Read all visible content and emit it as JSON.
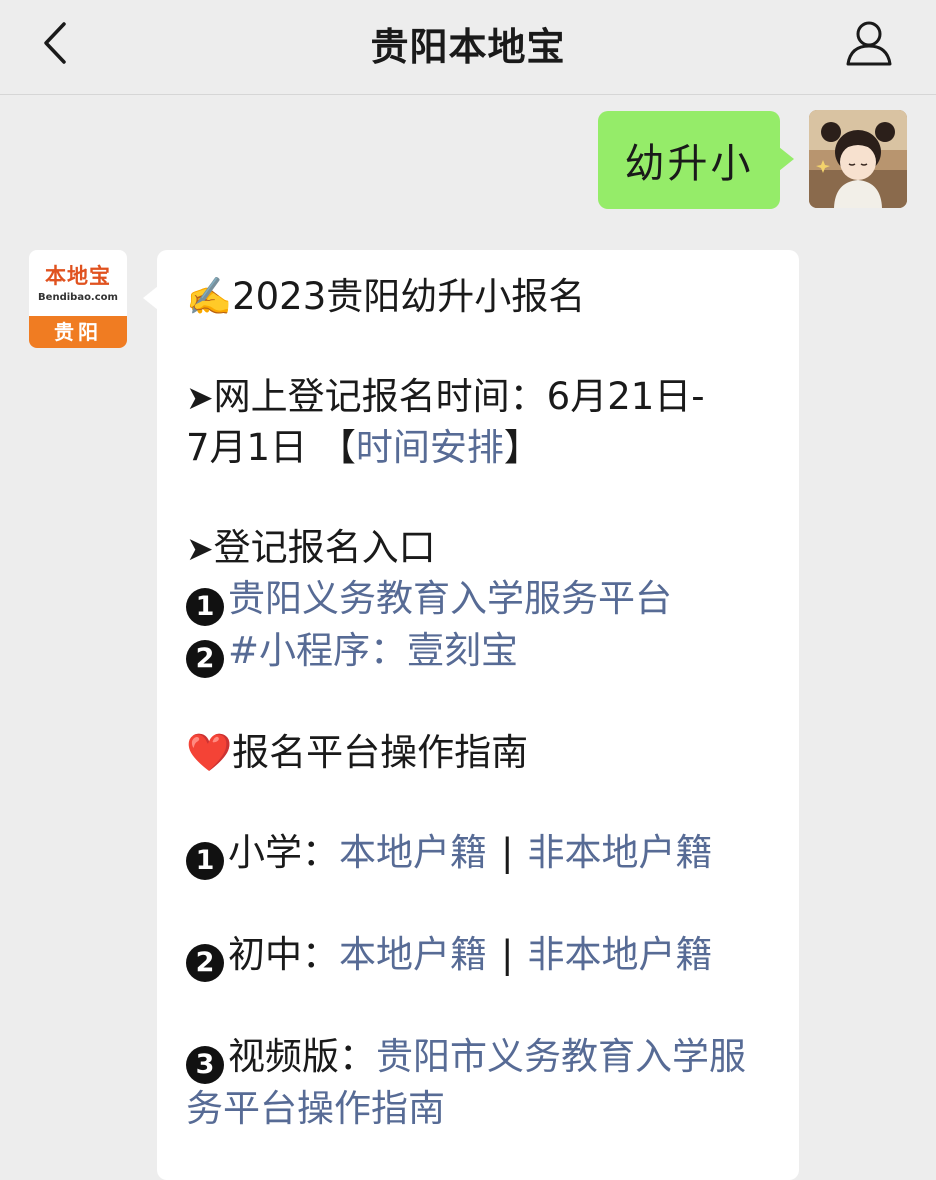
{
  "header": {
    "title": "贵阳本地宝",
    "back_icon": "chevron-left-icon",
    "profile_icon": "user-icon"
  },
  "outgoing": {
    "text": "幼升小",
    "bubble_color": "#95ec69"
  },
  "bot": {
    "avatar_brand": "本地宝",
    "avatar_domain": "Bendibao.com",
    "avatar_city": "贵阳"
  },
  "message": {
    "title_emoji": "✍️",
    "title": "2023贵阳幼升小报名",
    "arrow": "➤",
    "reg_time_label": "网上登记报名时间：6月21日-",
    "reg_time_end": "7月1日",
    "bracket_open": "【",
    "schedule_link": "时间安排",
    "bracket_close": "】",
    "entry_label": "登记报名入口",
    "entries": [
      {
        "num": "1",
        "text": "贵阳义务教育入学服务平台"
      },
      {
        "num": "2",
        "text": "#小程序：壹刻宝"
      }
    ],
    "heart": "❤️",
    "guide_title": "报名平台操作指南",
    "guides": [
      {
        "num": "1",
        "label": "小学：",
        "link1": "本地户籍",
        "sep": "|",
        "link2": "非本地户籍"
      },
      {
        "num": "2",
        "label": "初中：",
        "link1": "本地户籍",
        "sep": "|",
        "link2": "非本地户籍"
      }
    ],
    "video": {
      "num": "3",
      "label": "视频版：",
      "link": "贵阳市义务教育入学服务平台操作指南"
    }
  },
  "colors": {
    "background": "#ededed",
    "link": "#576b95"
  }
}
